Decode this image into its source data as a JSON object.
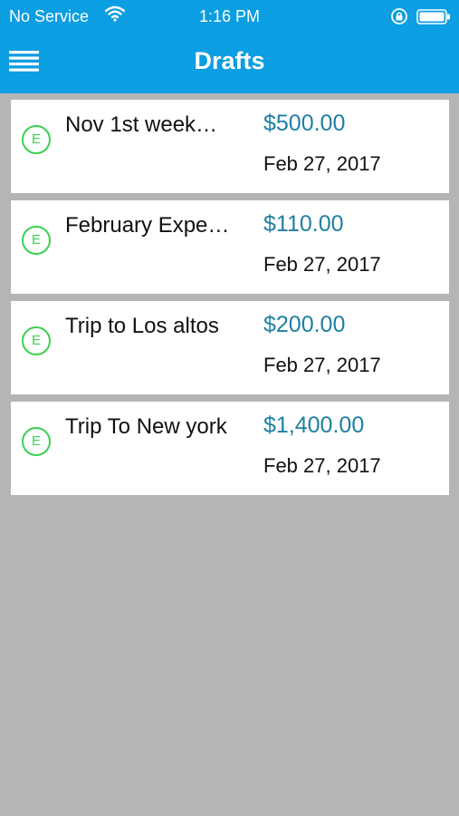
{
  "status": {
    "carrier": "No Service",
    "time": "1:16 PM"
  },
  "header": {
    "title": "Drafts"
  },
  "colors": {
    "header_bg": "#0c9ee2",
    "amount": "#1f7fa2",
    "badge": "#3ad14f",
    "background": "#b5b5b5"
  },
  "drafts": [
    {
      "badge": "E",
      "name": "Nov 1st week…",
      "amount": "$500.00",
      "date": "Feb 27, 2017"
    },
    {
      "badge": "E",
      "name": "February Expe…",
      "amount": "$110.00",
      "date": "Feb 27, 2017"
    },
    {
      "badge": "E",
      "name": "Trip to Los altos",
      "amount": "$200.00",
      "date": "Feb 27, 2017"
    },
    {
      "badge": "E",
      "name": "Trip To New york",
      "amount": "$1,400.00",
      "date": "Feb 27, 2017"
    }
  ]
}
